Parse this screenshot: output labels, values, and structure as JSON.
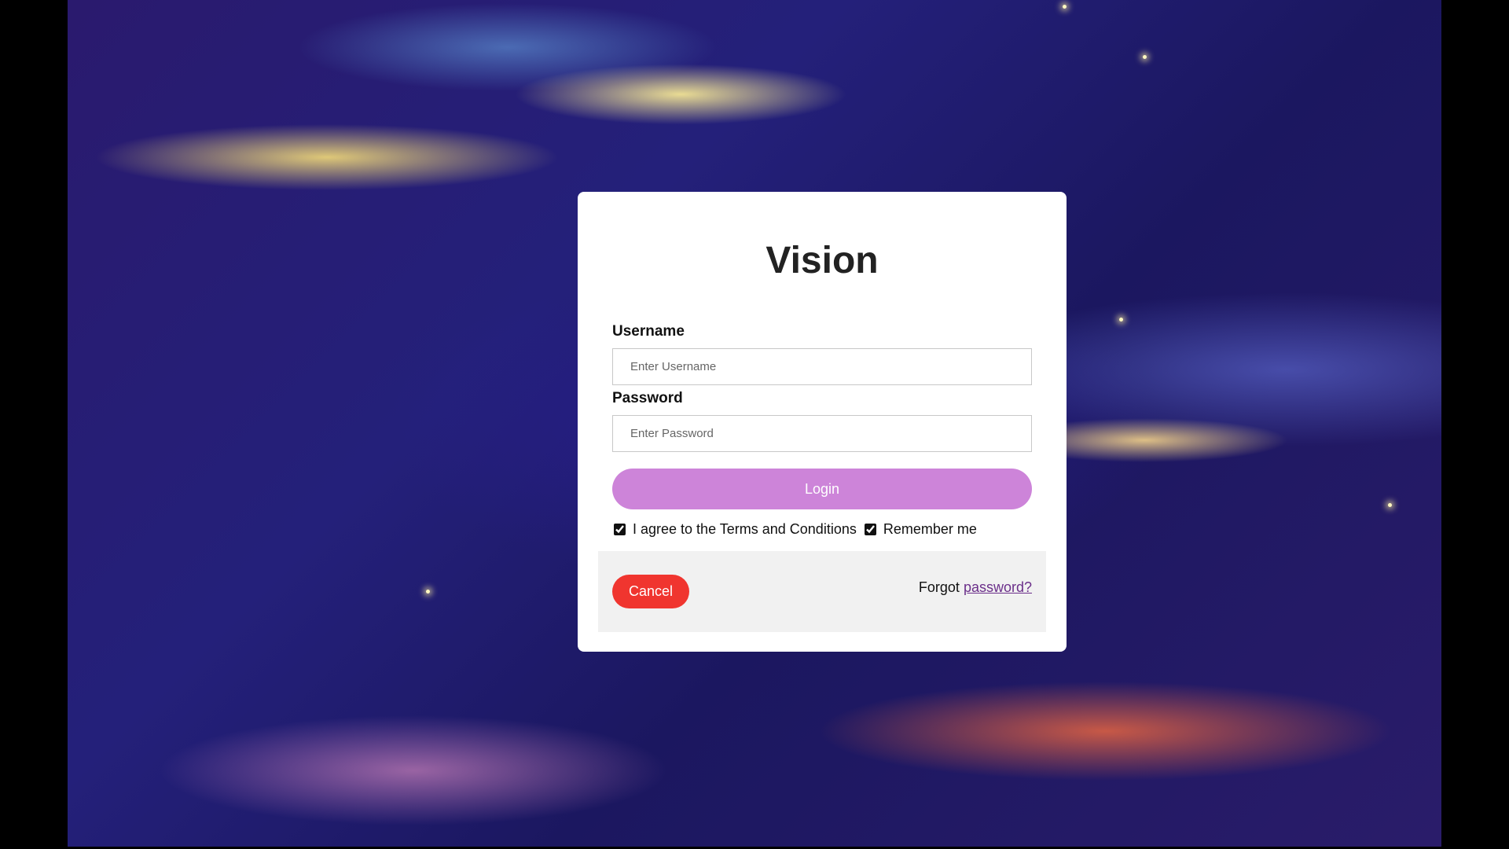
{
  "app": {
    "title": "Vision"
  },
  "form": {
    "username_label": "Username",
    "username_placeholder": "Enter Username",
    "username_value": "",
    "password_label": "Password",
    "password_placeholder": "Enter Password",
    "password_value": "",
    "login_label": "Login",
    "terms_label": "I agree to the Terms and Conditions",
    "terms_checked": true,
    "remember_label": "Remember me",
    "remember_checked": true
  },
  "footer": {
    "cancel_label": "Cancel",
    "forgot_prefix": "Forgot",
    "forgot_link": "password?"
  },
  "colors": {
    "login_button": "#cd84d9",
    "cancel_button": "#f0352f",
    "link": "#6b2f8a",
    "footer_background": "#f1f1f1"
  }
}
